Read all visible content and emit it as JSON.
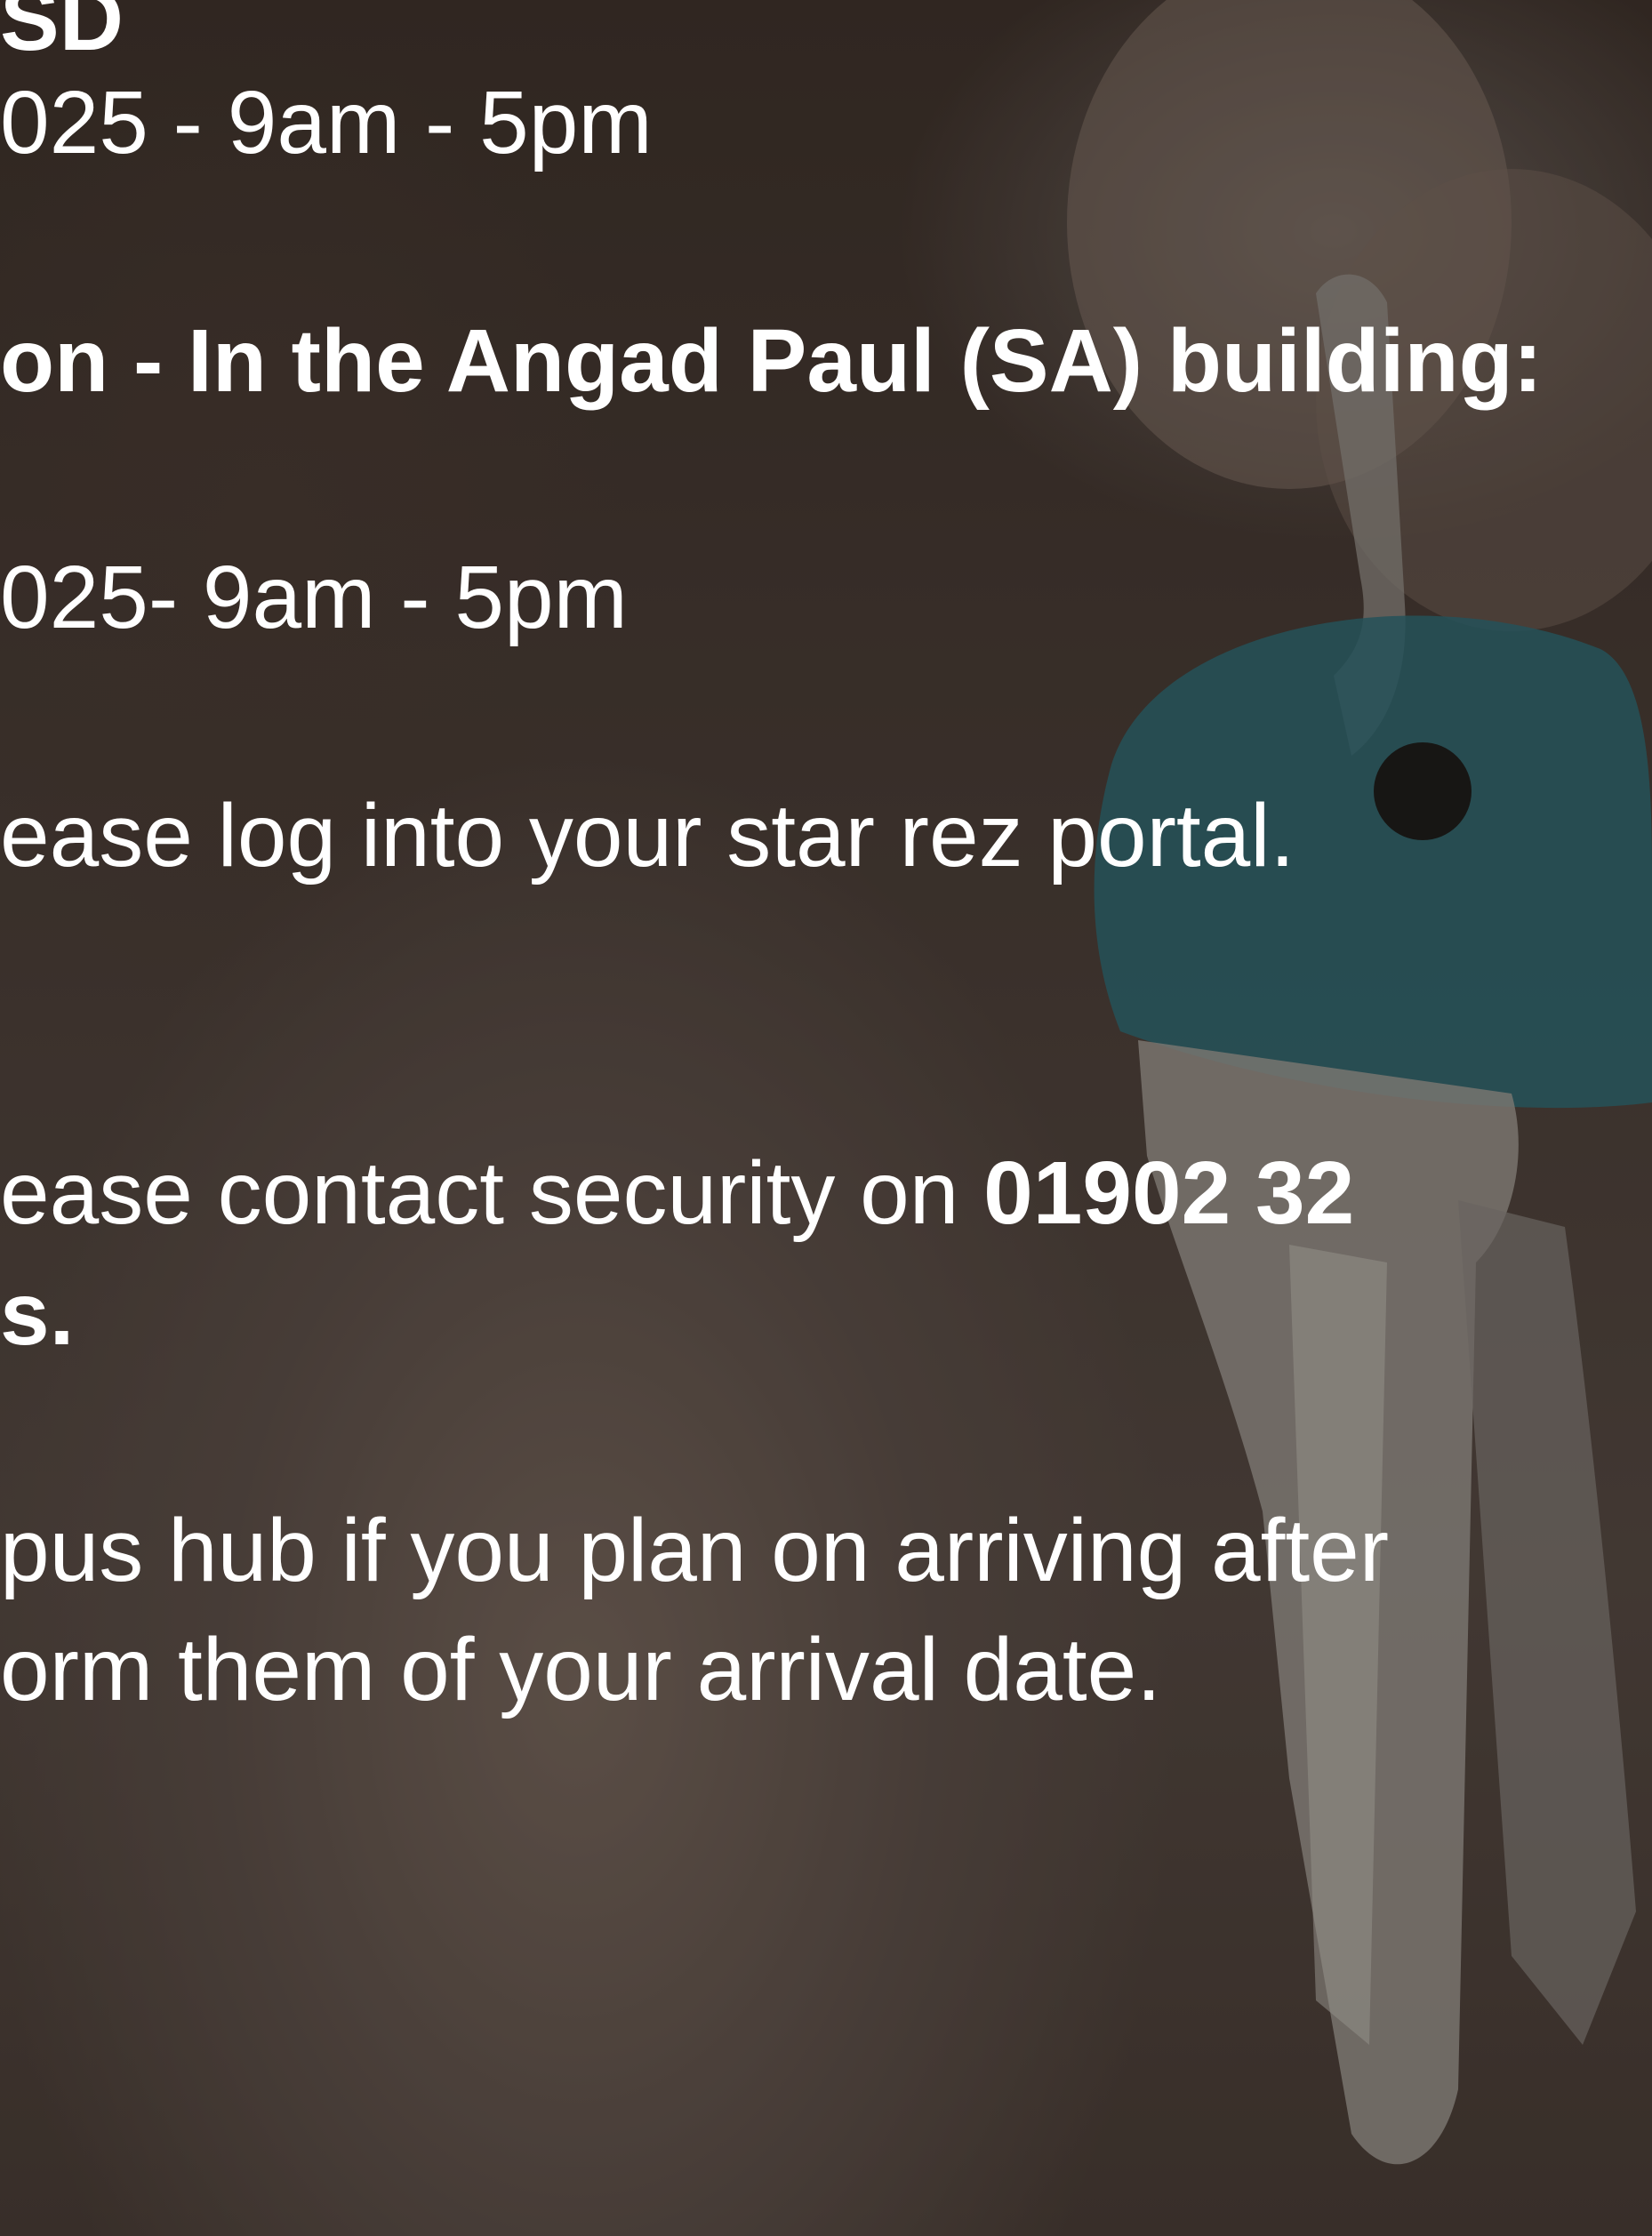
{
  "colors": {
    "text": "#ffffff",
    "key_head": "#2f6f7a"
  },
  "icons": {
    "background": "key-photo"
  },
  "lines": [
    {
      "parts": [
        {
          "text": "SD",
          "bold": true
        }
      ]
    },
    {
      "parts": [
        {
          "text": "025 - 9am - 5pm",
          "bold": false
        }
      ]
    },
    {
      "parts": [
        {
          "text": "on - In the Angad Paul (SA) building:",
          "bold": true
        }
      ]
    },
    {
      "parts": [
        {
          "text": "025- 9am - 5pm",
          "bold": false
        }
      ]
    },
    {
      "parts": [
        {
          "text": "ease log into your star rez portal.",
          "bold": false
        }
      ]
    },
    {
      "parts": [
        {
          "text": "ease contact security on ",
          "bold": false
        },
        {
          "text": "01902 32",
          "bold": true
        }
      ]
    },
    {
      "parts": [
        {
          "text": "s.",
          "bold": true
        }
      ]
    },
    {
      "parts": [
        {
          "text": "pus hub if you plan on arriving after",
          "bold": false
        }
      ]
    },
    {
      "parts": [
        {
          "text": "orm them of your arrival date.",
          "bold": false
        }
      ]
    }
  ]
}
